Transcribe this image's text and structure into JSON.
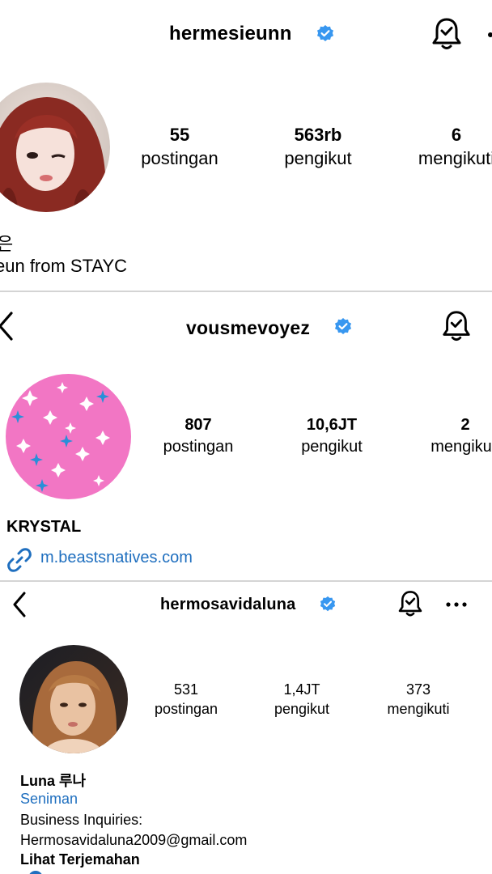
{
  "profiles": [
    {
      "username": "hermesieunn",
      "stats": [
        {
          "count": "55",
          "label": "postingan"
        },
        {
          "count": "563rb",
          "label": "pengikut"
        },
        {
          "count": "6",
          "label": "mengikuti"
        }
      ],
      "bio_lines": [
        "은",
        "eun from STAYC"
      ]
    },
    {
      "username": "vousmevoyez",
      "stats": [
        {
          "count": "807",
          "label": "postingan"
        },
        {
          "count": "10,6JT",
          "label": "pengikut"
        },
        {
          "count": "2",
          "label": "mengikuti"
        }
      ],
      "name": "KRYSTAL",
      "link": "m.beastsnatives.com"
    },
    {
      "username": "hermosavidaluna",
      "stats": [
        {
          "count": "531",
          "label": "postingan"
        },
        {
          "count": "1,4JT",
          "label": "pengikut"
        },
        {
          "count": "373",
          "label": "mengikuti"
        }
      ],
      "name": "Luna 루나",
      "category": "Seniman",
      "bio_lines": [
        "Business Inquiries:",
        "Hermosavidaluna2009@gmail.com"
      ],
      "translate": "Lihat Terjemahan"
    }
  ],
  "icons": {
    "back": "chevron-left-icon",
    "notifications": "bell-check-icon",
    "verified": "verified-badge-icon",
    "more": "more-horizontal-icon",
    "link": "link-icon"
  },
  "colors": {
    "verified": "#3897f0",
    "link": "#1f6fbf",
    "separator": "#d4d4d4"
  }
}
